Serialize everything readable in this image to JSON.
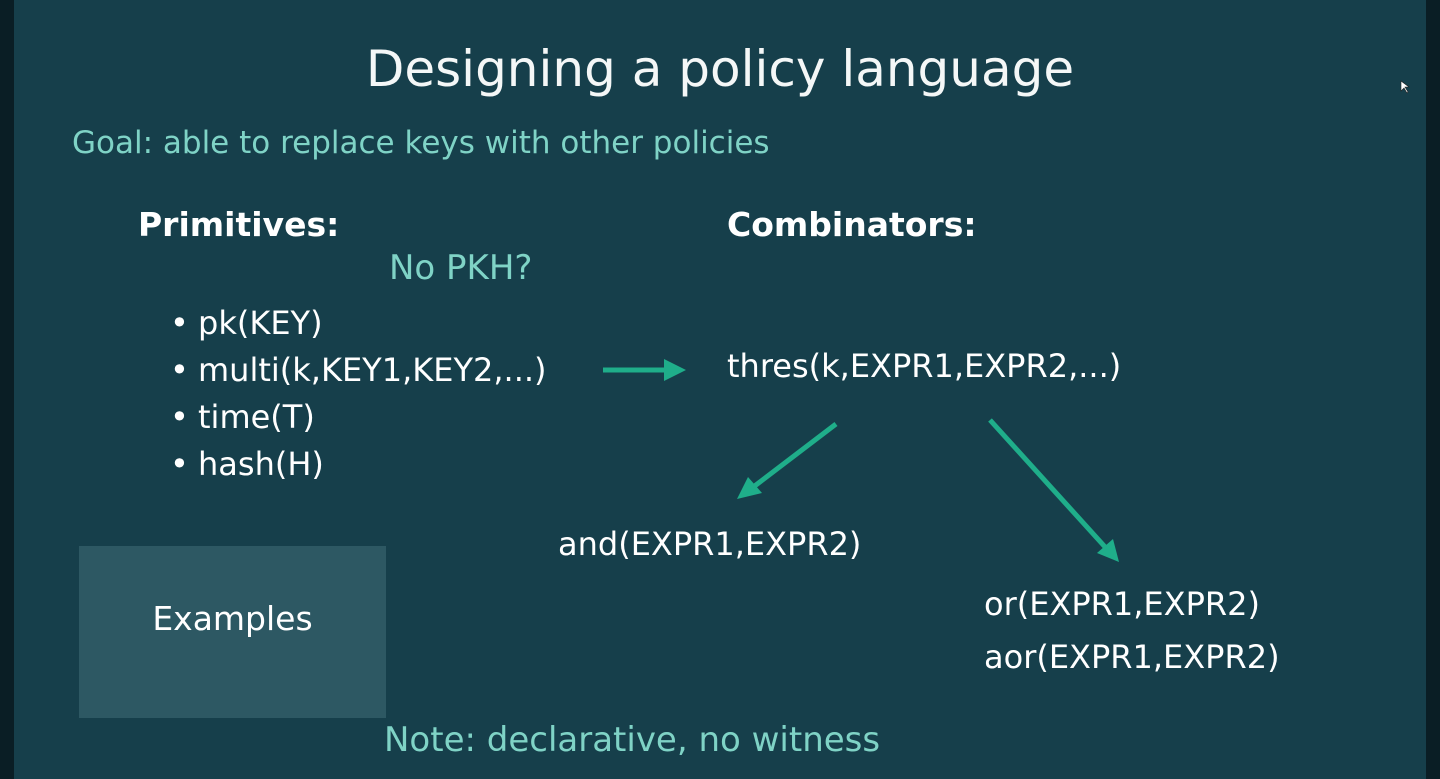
{
  "slide": {
    "title": "Designing a policy language",
    "goal": "Goal: able to replace keys with other policies",
    "primitives_heading": "Primitives:",
    "combinators_heading": "Combinators:",
    "no_pkh": "No PKH?",
    "primitives": [
      "pk(KEY)",
      "multi(k,KEY1,KEY2,...)",
      "time(T)",
      "hash(H)"
    ],
    "bullet": "•",
    "thres": "thres(k,EXPR1,EXPR2,...)",
    "and": "and(EXPR1,EXPR2)",
    "or": "or(EXPR1,EXPR2)",
    "aor": "aor(EXPR1,EXPR2)",
    "examples": "Examples",
    "note": "Note: declarative, no witness"
  },
  "colors": {
    "background": "#163f4b",
    "accent_text": "#7fd3c6",
    "arrow": "#1fae8a",
    "examples_box": "#2d5863"
  },
  "icons": [
    "arrow-right-icon",
    "arrow-down-left-icon",
    "arrow-down-right-icon",
    "cursor-icon"
  ]
}
